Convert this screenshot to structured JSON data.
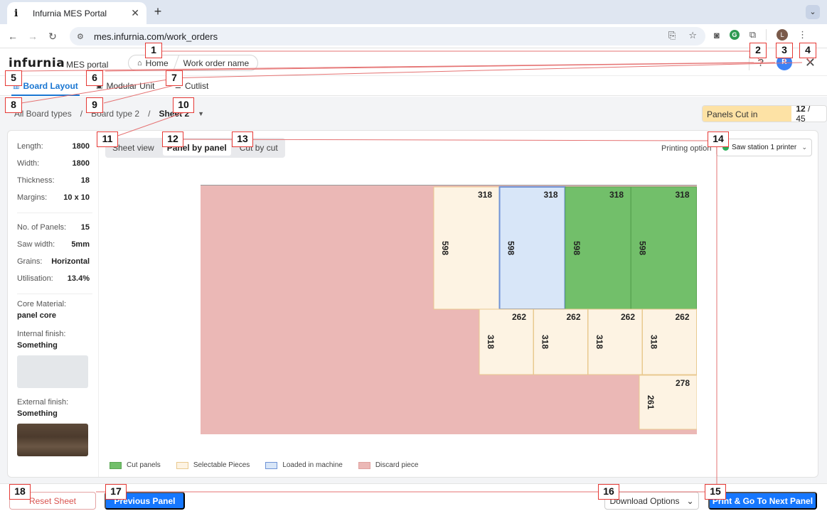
{
  "browser": {
    "tab_title": "Infurnia MES Portal",
    "tab_favicon": "i",
    "url": "mes.infurnia.com/work_orders",
    "profile_initial": "L"
  },
  "header": {
    "logo": "infurnia",
    "portal_label": "MES portal",
    "breadcrumb": [
      "Home",
      "Work order name"
    ],
    "help": "?",
    "user_initial": "R"
  },
  "view_tabs": [
    {
      "label": "Board Layout",
      "icon": "board-icon",
      "active": true
    },
    {
      "label": "Modular Unit",
      "icon": "cube-icon",
      "active": false
    },
    {
      "label": "Cutlist",
      "icon": "list-icon",
      "active": false
    }
  ],
  "nav_crumbs": [
    "All Board types",
    "Board type 2",
    "Sheet 2"
  ],
  "sheet_counter": {
    "label": "Panels Cut in sheets:",
    "current": "12",
    "total": "/ 45"
  },
  "specs": {
    "rows_a": [
      {
        "k": "Length:",
        "v": "1800"
      },
      {
        "k": "Width:",
        "v": "1800"
      },
      {
        "k": "Thickness:",
        "v": "18"
      },
      {
        "k": "Margins:",
        "v": "10 x 10"
      }
    ],
    "rows_b": [
      {
        "k": "No. of Panels:",
        "v": "15"
      },
      {
        "k": "Saw width:",
        "v": "5mm"
      },
      {
        "k": "Grains:",
        "v": "Horizontal"
      },
      {
        "k": "Utilisation:",
        "v": "13.4%"
      }
    ],
    "core_label": "Core Material:",
    "core_value": "panel core",
    "internal_label": "Internal finish:",
    "internal_value": "Something",
    "external_label": "External finish:",
    "external_value": "Something"
  },
  "mode_tabs": [
    "Sheet view",
    "Panel by panel",
    "Cut by cut"
  ],
  "printing": {
    "label": "Printing option",
    "selected": "Saw station 1 printer"
  },
  "panels": {
    "row1": [
      {
        "w": "318",
        "h": "598",
        "state": "selectable"
      },
      {
        "w": "318",
        "h": "598",
        "state": "loaded"
      },
      {
        "w": "318",
        "h": "598",
        "state": "cut"
      },
      {
        "w": "318",
        "h": "598",
        "state": "cut"
      }
    ],
    "row2": [
      {
        "w": "262",
        "h": "318",
        "state": "selectable"
      },
      {
        "w": "262",
        "h": "318",
        "state": "selectable"
      },
      {
        "w": "262",
        "h": "318",
        "state": "selectable"
      },
      {
        "w": "262",
        "h": "318",
        "state": "selectable"
      }
    ],
    "row3": [
      {
        "w": "278",
        "h": "261",
        "state": "selectable"
      }
    ]
  },
  "colors": {
    "discard": "#ebb8b6",
    "selectable": "#fdf3e3",
    "selectable_border": "#e9c98f",
    "loaded": "#d8e6f8",
    "loaded_border": "#6f93d6",
    "cut": "#72bf6a",
    "cut_border": "#5aa553"
  },
  "legend": [
    "Cut panels",
    "Selectable Pieces",
    "Loaded in machine",
    "Discard piece"
  ],
  "footer": {
    "reset": "Reset Sheet",
    "previous": "Previous Panel",
    "download": "Download Options",
    "next": "Print & Go To Next Panel"
  },
  "annotations": [
    "1",
    "2",
    "3",
    "4",
    "5",
    "6",
    "7",
    "8",
    "9",
    "10",
    "11",
    "12",
    "13",
    "14",
    "15",
    "16",
    "17",
    "18"
  ]
}
